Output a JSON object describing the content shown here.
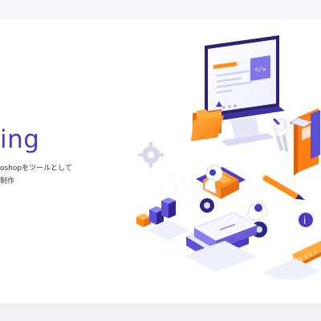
{
  "hero": {
    "title": "ing",
    "description_line_1": "oshopをツールとして",
    "description_line_2": "制作"
  },
  "illustration": {
    "monitor_code_icon": "</>",
    "info_icon": "i"
  },
  "colors": {
    "accent": "#4b3ac8",
    "orange": "#ff8d1a",
    "orange_dark": "#e56f12",
    "purple_dark": "#31248f",
    "purple_mid": "#6a5bd7",
    "light_surface": "#f4f4fb"
  }
}
